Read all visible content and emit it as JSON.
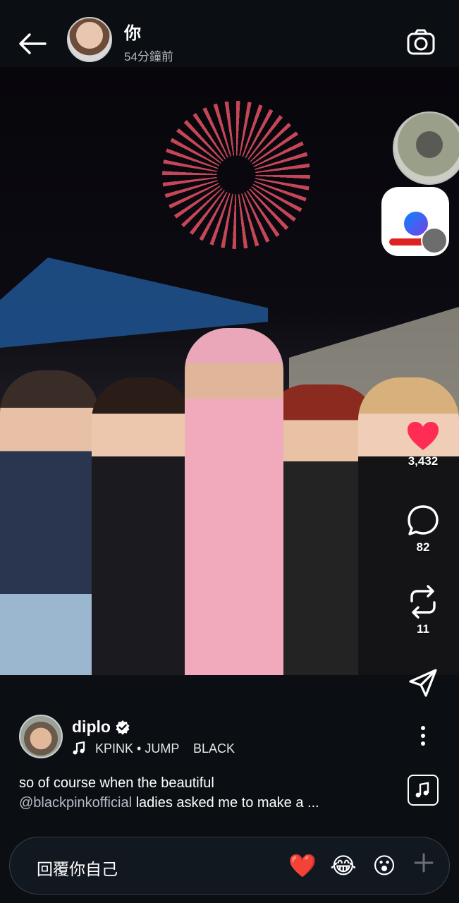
{
  "header": {
    "username": "你",
    "timestamp": "54分鐘前"
  },
  "actions": {
    "likes": "3,432",
    "comments": "82",
    "reposts": "11"
  },
  "post": {
    "author": "diplo",
    "music": "KPINK • JUMP    BLACK",
    "caption_text": "so of course when the beautiful",
    "caption_mention": "@blackpinkofficial",
    "caption_rest": " ladies asked me to make a ..."
  },
  "reply": {
    "placeholder": "回覆你自己",
    "emojis": [
      "❤️",
      "😂",
      "😮"
    ]
  },
  "colors": {
    "background": "#0b0f14",
    "like": "#ff2d55",
    "mention": "#b5bdc7"
  }
}
